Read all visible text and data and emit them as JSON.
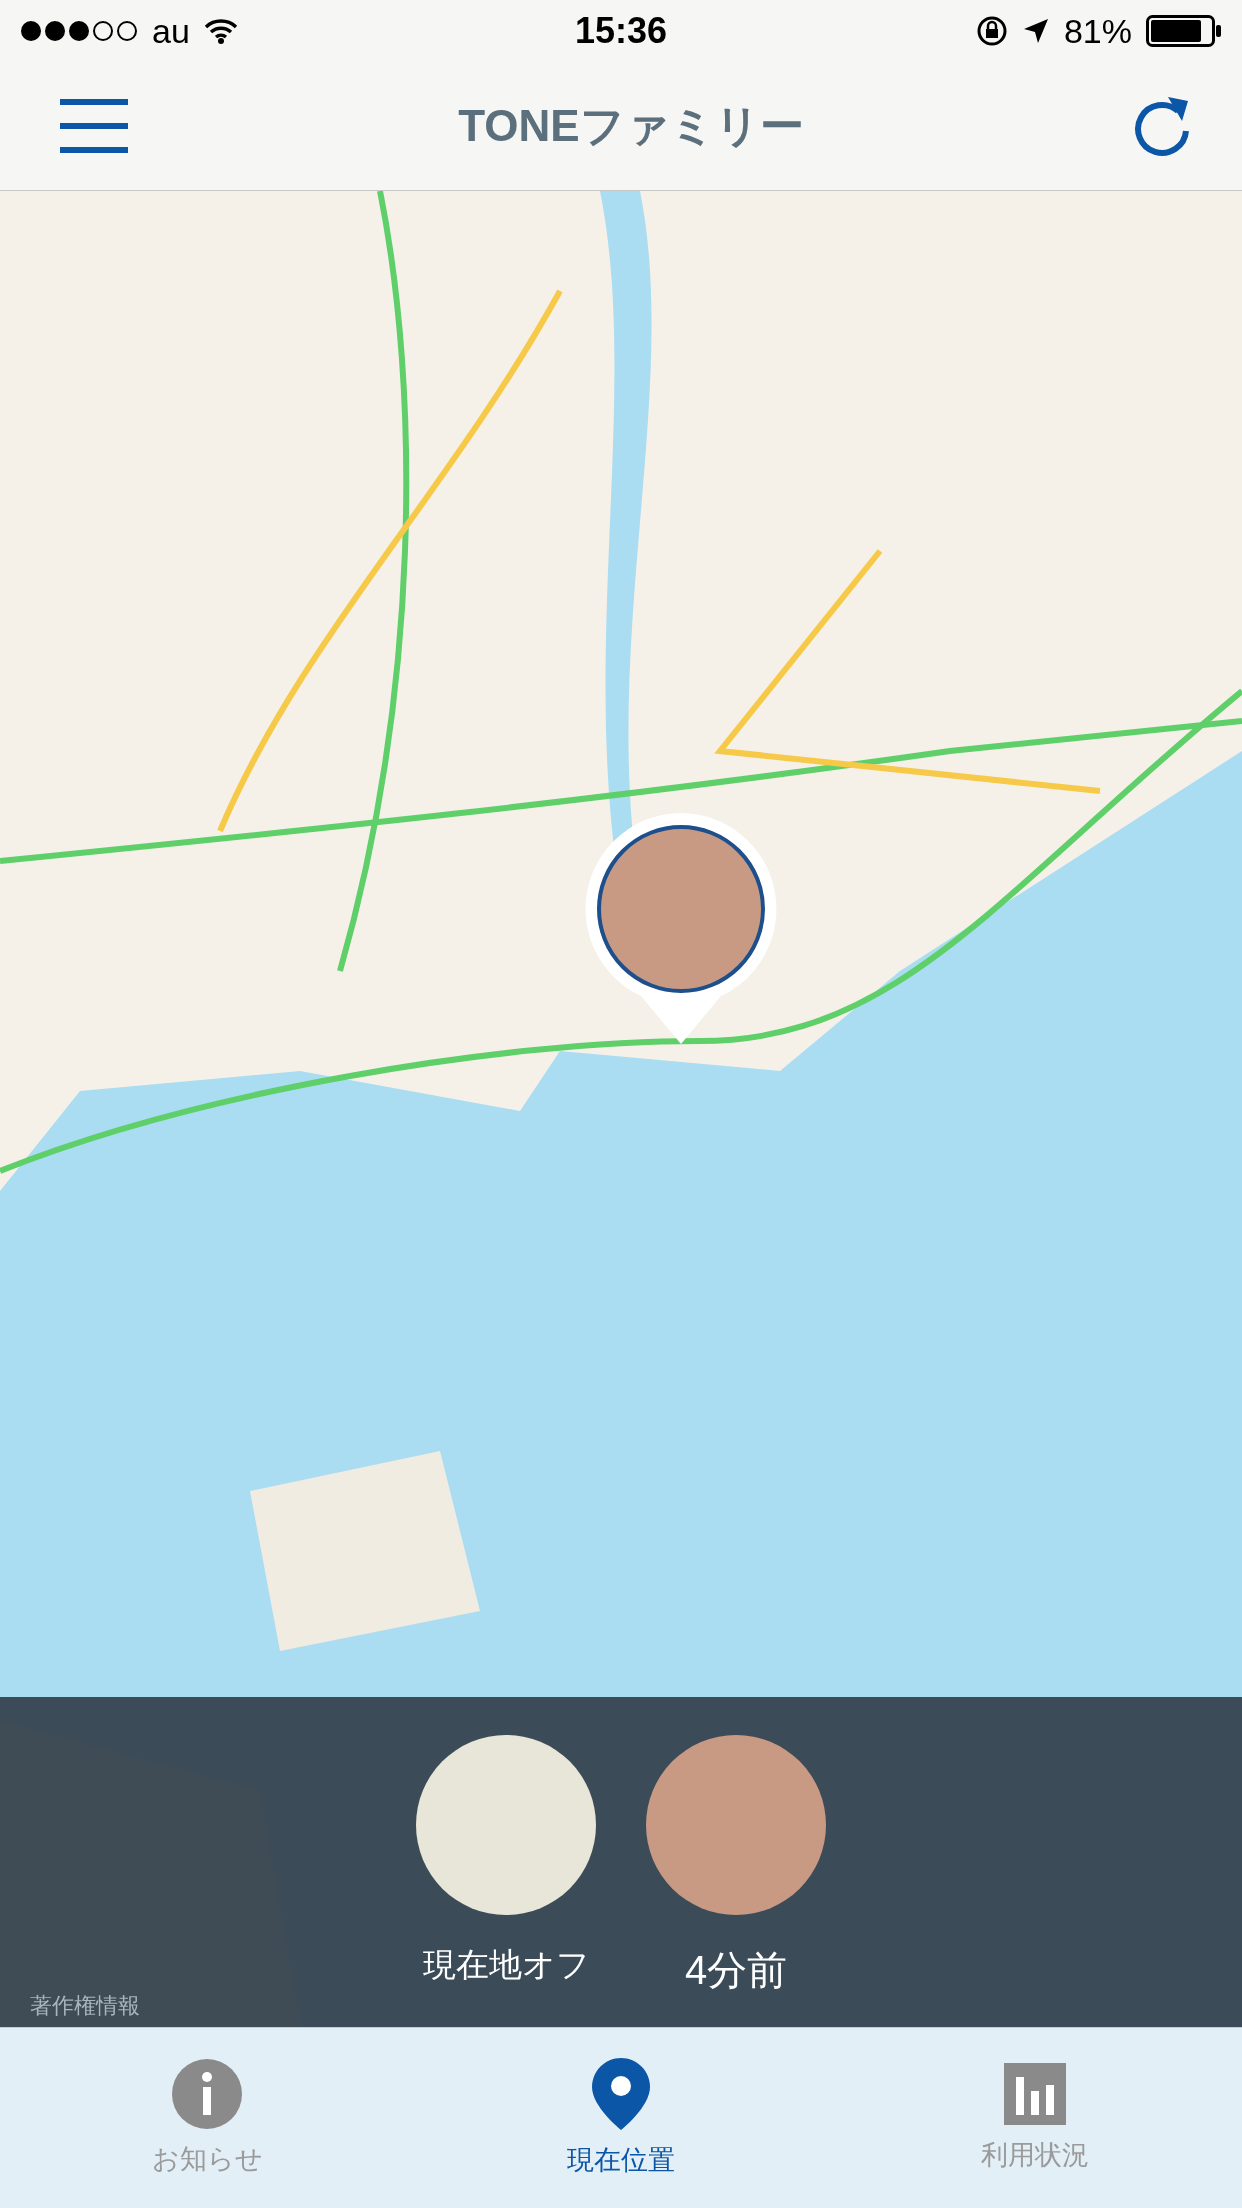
{
  "status_bar": {
    "carrier": "au",
    "time": "15:36",
    "battery": "81%"
  },
  "nav": {
    "title": "TONEファミリー"
  },
  "map": {
    "legal": "著作権情報"
  },
  "members": [
    {
      "kind": "off",
      "status": "現在地オフ"
    },
    {
      "kind": "time",
      "status": "4分前"
    }
  ],
  "tabs": [
    {
      "kind": "info",
      "label": "お知らせ",
      "selected": false
    },
    {
      "kind": "location",
      "label": "現在位置",
      "selected": true
    },
    {
      "kind": "usage",
      "label": "利用状況",
      "selected": false
    }
  ]
}
